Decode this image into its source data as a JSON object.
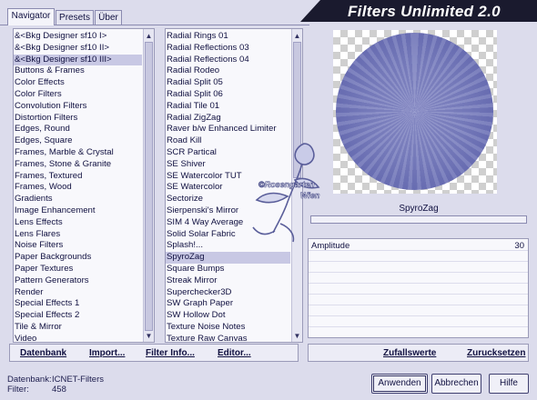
{
  "title": "Filters Unlimited 2.0",
  "tabs": [
    {
      "label": "Navigator",
      "active": true
    },
    {
      "label": "Presets",
      "active": false
    },
    {
      "label": "Über",
      "active": false
    }
  ],
  "categories": {
    "selected_index": 2,
    "items": [
      "&<Bkg Designer sf10 I>",
      "&<Bkg Designer sf10 II>",
      "&<Bkg Designer sf10 III>",
      "Buttons & Frames",
      "Color Effects",
      "Color Filters",
      "Convolution Filters",
      "Distortion Filters",
      "Edges, Round",
      "Edges, Square",
      "Frames, Marble & Crystal",
      "Frames, Stone & Granite",
      "Frames, Textured",
      "Frames, Wood",
      "Gradients",
      "Image Enhancement",
      "Lens Effects",
      "Lens Flares",
      "Noise Filters",
      "Paper Backgrounds",
      "Paper Textures",
      "Pattern Generators",
      "Render",
      "Special Effects 1",
      "Special Effects 2",
      "Tile & Mirror",
      "Video"
    ]
  },
  "filters": {
    "selected_index": 19,
    "items": [
      "Radial  Rings 01",
      "Radial Reflections 03",
      "Radial Reflections 04",
      "Radial Rodeo",
      "Radial Split 05",
      "Radial Split 06",
      "Radial Tile 01",
      "Radial ZigZag",
      "Raver b/w Enhanced Limiter",
      "Road Kill",
      "SCR  Partical",
      "SE Shiver",
      "SE Watercolor TUT",
      "SE Watercolor",
      "Sectorize",
      "Sierpenski's Mirror",
      "SIM 4 Way Average",
      "Solid Solar Fabric",
      "Splash!...",
      "SpyroZag",
      "Square Bumps",
      "Streak Mirror",
      "Superchecker3D",
      "SW Graph Paper",
      "SW Hollow Dot",
      "Texture Noise Notes",
      "Texture Raw Canvas"
    ]
  },
  "scroll_arrows": {
    "up": "▲",
    "down": "▼"
  },
  "current_filter": "SpyroZag",
  "params": [
    {
      "label": "Amplitude",
      "value": "30"
    }
  ],
  "watermark": {
    "line1": "©Rosengarten",
    "line2": "Wien"
  },
  "toolbar": {
    "datenbank": "Datenbank",
    "import": "Import...",
    "filter_info": "Filter Info...",
    "editor": "Editor...",
    "zufallswerte": "Zufallswerte",
    "zuruecksetzen": "Zurucksetzen"
  },
  "status": {
    "db_label": "Datenbank:",
    "db_value": "ICNET-Filters",
    "filter_label": "Filter:",
    "filter_value": "458"
  },
  "buttons": {
    "apply": "Anwenden",
    "cancel": "Abbrechen",
    "help": "Hilfe"
  },
  "colors": {
    "accent": "#c8c8e4",
    "preview_disc": "#7a7fbe",
    "banner": "#1a1a2e"
  }
}
